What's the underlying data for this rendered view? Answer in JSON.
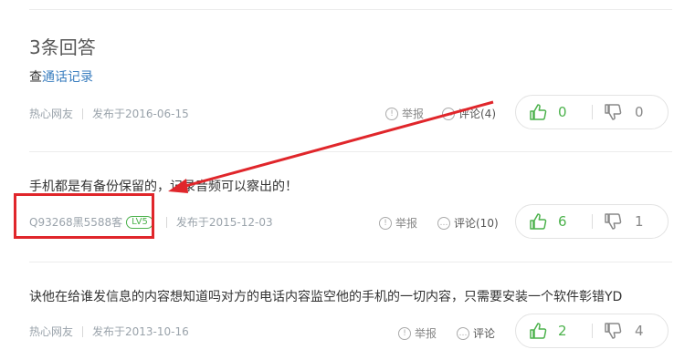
{
  "header": {
    "title": "3条回答",
    "query_prefix": "查",
    "query_link": "通话记录"
  },
  "colors": {
    "vote_up": "#4cb24c",
    "annotation_red": "#e0262b",
    "link": "#3a7ebf"
  },
  "answers": [
    {
      "text": "",
      "user": "热心网友",
      "level": "",
      "date": "发布于2016-06-15",
      "report": "举报",
      "comment": "评论(4)",
      "up": "0",
      "down": "0"
    },
    {
      "text": "手机都是有备份保留的，记录音频可以察出的！",
      "user": "Q93268黑5588客",
      "level": "LV5",
      "date": "发布于2015-12-03",
      "report": "举报",
      "comment": "评论(10)",
      "up": "6",
      "down": "1"
    },
    {
      "text": "诀他在给谁发信息的内容想知道吗对方的电话内容监空他的手机的一切内容，只需要安装一个软件彰错YD",
      "user": "热心网友",
      "level": "",
      "date": "发布于2013-10-16",
      "report": "举报",
      "comment": "评论",
      "up": "2",
      "down": "4"
    }
  ],
  "icons": {
    "report": "warning-circle-icon",
    "comment": "comment-bubble-icon",
    "thumb_up": "thumb-up-icon",
    "thumb_down": "thumb-down-icon"
  }
}
